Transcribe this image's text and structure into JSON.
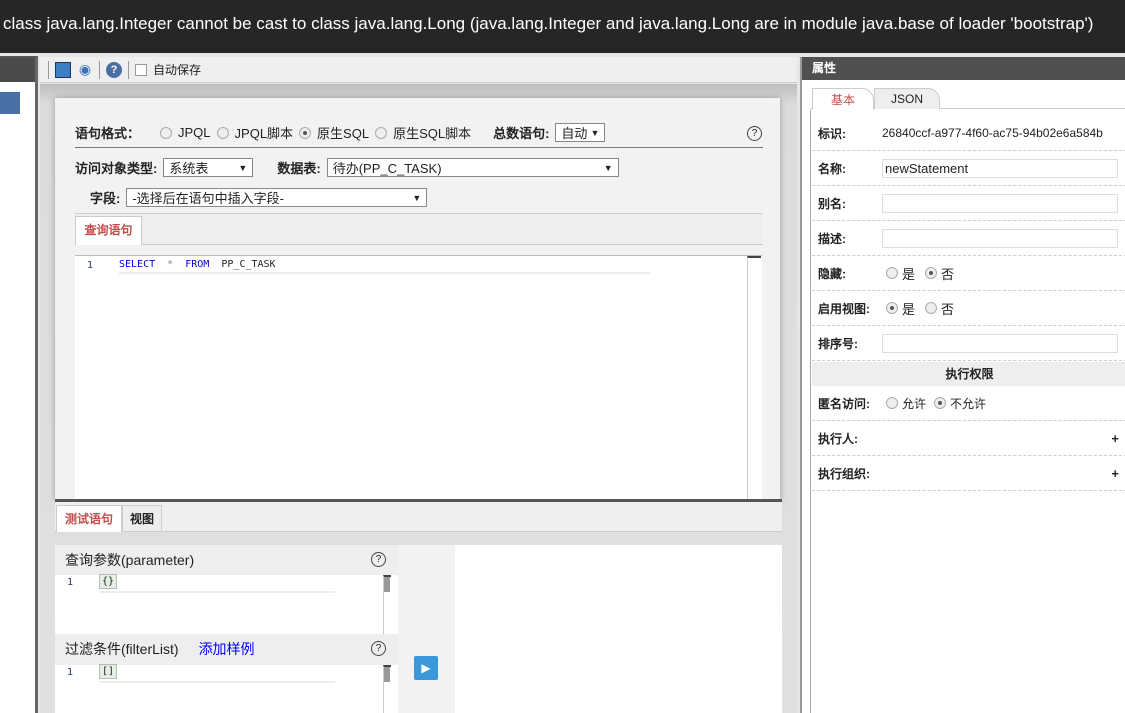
{
  "error_message": "class java.lang.Integer cannot be cast to class java.lang.Long (java.lang.Integer and java.lang.Long are in module java.base of loader 'bootstrap')",
  "toolbar": {
    "autosave_label": "自动保存"
  },
  "form": {
    "format_label": "语句格式：",
    "formats": [
      "JPQL",
      "JPQL脚本",
      "原生SQL",
      "原生SQL脚本"
    ],
    "selected_format": "原生SQL",
    "count_label": "总数语句:",
    "count_value": "自动",
    "object_type_label": "访问对象类型:",
    "object_type_value": "系统表",
    "table_label": "数据表:",
    "table_value": "待办(PP_C_TASK)",
    "field_label": "字段:",
    "field_placeholder": "-选择后在语句中插入字段-",
    "query_tab": "查询语句",
    "line_no": "1",
    "sql": {
      "kw1": "SELECT",
      "star": "*",
      "kw2": "FROM",
      "table": "PP_C_TASK"
    }
  },
  "bottom": {
    "tabs": [
      "测试语句",
      "视图"
    ],
    "param_title": "查询参数(parameter)",
    "param_value": "{}",
    "filter_title": "过滤条件(filterList)",
    "add_sample": "添加样例",
    "filter_value": "[]",
    "line_no": "1"
  },
  "props": {
    "title": "属性",
    "tabs": [
      "基本",
      "JSON"
    ],
    "id_label": "标识:",
    "id_value": "26840ccf-a977-4f60-ac75-94b02e6a584b",
    "name_label": "名称:",
    "name_value": "newStatement",
    "alias_label": "别名:",
    "desc_label": "描述:",
    "hidden_label": "隐藏:",
    "enable_view_label": "启用视图:",
    "yes": "是",
    "no": "否",
    "order_label": "排序号:",
    "perm_title": "执行权限",
    "anon_label": "匿名访问:",
    "allow": "允许",
    "deny": "不允许",
    "executor_label": "执行人:",
    "exec_org_label": "执行组织:",
    "plus": "+"
  }
}
